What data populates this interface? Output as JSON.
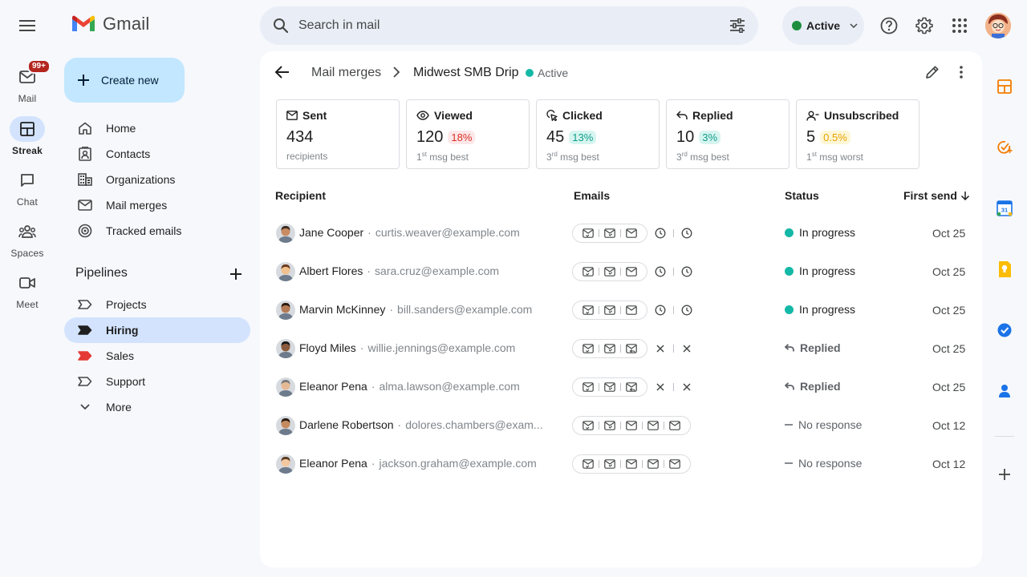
{
  "app": {
    "logo_text": "Gmail"
  },
  "rail": {
    "mail": {
      "label": "Mail",
      "badge": "99+"
    },
    "streak": {
      "label": "Streak"
    },
    "chat": {
      "label": "Chat"
    },
    "spaces": {
      "label": "Spaces"
    },
    "meet": {
      "label": "Meet"
    }
  },
  "search": {
    "placeholder": "Search in mail"
  },
  "status": {
    "label": "Active",
    "color": "#1e8e3e"
  },
  "sidebar": {
    "compose_label": "Create new",
    "items": [
      {
        "label": "Home",
        "icon": "home-icon"
      },
      {
        "label": "Contacts",
        "icon": "contacts-icon"
      },
      {
        "label": "Organizations",
        "icon": "organizations-icon"
      },
      {
        "label": "Mail merges",
        "icon": "mail-merges-icon"
      },
      {
        "label": "Tracked emails",
        "icon": "tracked-emails-icon"
      }
    ],
    "pipelines_title": "Pipelines",
    "pipelines": [
      {
        "label": "Projects",
        "color": "#444746",
        "filled": false
      },
      {
        "label": "Hiring",
        "color": "#1f1f1f",
        "filled": true,
        "active": true
      },
      {
        "label": "Sales",
        "color": "#e53935",
        "filled": true
      },
      {
        "label": "Support",
        "color": "#444746",
        "filled": false
      }
    ],
    "more_label": "More"
  },
  "header": {
    "breadcrumb_link": "Mail merges",
    "title": "Midwest SMB Drip",
    "status": "Active",
    "status_color": "#14b8a6"
  },
  "stats": [
    {
      "label": "Sent",
      "value": "434",
      "pct": "",
      "sub_a": "recipients",
      "sup": "",
      "sub_b": "",
      "icon": "mail-icon"
    },
    {
      "label": "Viewed",
      "value": "120",
      "pct": "18%",
      "pct_color": "red",
      "sub_a": "1",
      "sup": "st",
      "sub_b": " msg best",
      "icon": "eye-icon"
    },
    {
      "label": "Clicked",
      "value": "45",
      "pct": "13%",
      "pct_color": "teal",
      "sub_a": "3",
      "sup": "rd",
      "sub_b": " msg best",
      "icon": "click-icon"
    },
    {
      "label": "Replied",
      "value": "10",
      "pct": "3%",
      "pct_color": "teal",
      "sub_a": "3",
      "sup": "rd",
      "sub_b": " msg best",
      "icon": "reply-icon"
    },
    {
      "label": "Unsubscribed",
      "value": "5",
      "pct": "0.5%",
      "pct_color": "yellow",
      "sub_a": "1",
      "sup": "st",
      "sub_b": " msg worst",
      "icon": "unsubscribe-icon"
    }
  ],
  "table": {
    "headers": {
      "recipient": "Recipient",
      "emails": "Emails",
      "status": "Status",
      "first_send": "First send"
    },
    "sort": "descending",
    "rows": [
      {
        "name": "Jane Cooper",
        "email": "curtis.weaver@example.com",
        "emails": [
          "sent",
          "opened",
          "mail",
          "clock",
          "clock"
        ],
        "sent_count": 3,
        "status": "In progress",
        "status_type": "progress",
        "date": "Oct 25"
      },
      {
        "name": "Albert Flores",
        "email": "sara.cruz@example.com",
        "emails": [
          "sent",
          "opened",
          "mail",
          "clock",
          "clock"
        ],
        "sent_count": 3,
        "status": "In progress",
        "status_type": "progress",
        "date": "Oct 25"
      },
      {
        "name": "Marvin McKinney",
        "email": "bill.sanders@example.com",
        "emails": [
          "sent",
          "opened",
          "mail",
          "clock",
          "clock"
        ],
        "sent_count": 3,
        "status": "In progress",
        "status_type": "progress",
        "date": "Oct 25"
      },
      {
        "name": "Floyd Miles",
        "email": "willie.jennings@example.com",
        "emails": [
          "sent",
          "opened",
          "replied",
          "x",
          "x"
        ],
        "sent_count": 3,
        "status": "Replied",
        "status_type": "replied",
        "date": "Oct 25"
      },
      {
        "name": "Eleanor Pena",
        "email": "alma.lawson@example.com",
        "emails": [
          "sent",
          "opened",
          "replied",
          "x",
          "x"
        ],
        "sent_count": 3,
        "status": "Replied",
        "status_type": "replied",
        "date": "Oct 25"
      },
      {
        "name": "Darlene Robertson",
        "email": "dolores.chambers@exam...",
        "emails": [
          "sent",
          "opened",
          "mail",
          "mail",
          "mail"
        ],
        "sent_count": 5,
        "status": "No response",
        "status_type": "none",
        "date": "Oct 12"
      },
      {
        "name": "Eleanor Pena",
        "email": "jackson.graham@example.com",
        "emails": [
          "sent",
          "opened",
          "mail",
          "mail",
          "mail"
        ],
        "sent_count": 5,
        "status": "No response",
        "status_type": "none",
        "date": "Oct 12"
      }
    ]
  },
  "side_apps": [
    {
      "name": "streak-app-icon",
      "color": "#f57c00"
    },
    {
      "name": "streak-tasks-icon",
      "color": "#f57c00"
    },
    {
      "name": "calendar-icon",
      "color": "#1a73e8"
    },
    {
      "name": "keep-icon",
      "color": "#fbbc04"
    },
    {
      "name": "tasks-icon",
      "color": "#1a73e8"
    },
    {
      "name": "contacts-app-icon",
      "color": "#1a73e8"
    }
  ]
}
